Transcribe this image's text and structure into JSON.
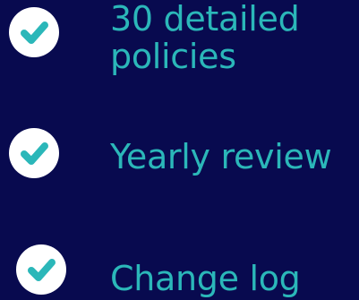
{
  "background_color": "#080a4f",
  "accent_color": "#2bb7b9",
  "check_color": "#2bb7b9",
  "badge_color": "#ffffff",
  "features": [
    {
      "icon": "check-circle-icon",
      "line1": "30 detailed",
      "line2": "policies"
    },
    {
      "icon": "check-circle-icon",
      "line1": "Yearly review"
    },
    {
      "icon": "check-circle-icon",
      "line1": "Change log"
    }
  ]
}
